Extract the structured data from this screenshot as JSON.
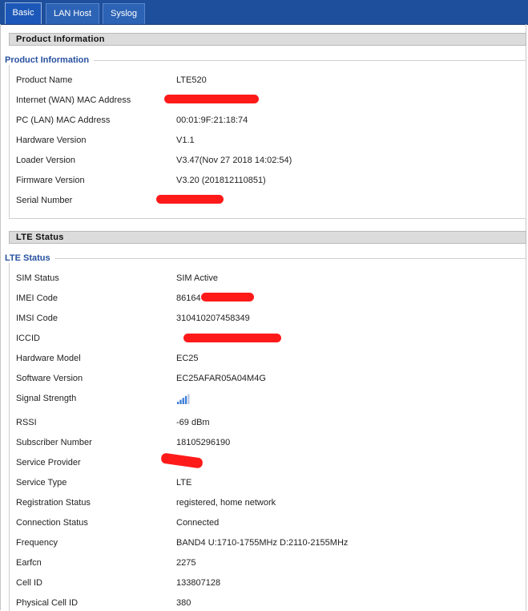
{
  "tabs": [
    {
      "label": "Basic"
    },
    {
      "label": "LAN Host"
    },
    {
      "label": "Syslog"
    }
  ],
  "product_section": {
    "bar_title": "Product Information",
    "legend": "Product Information",
    "rows": [
      {
        "label": "Product Name",
        "value": "LTE520"
      },
      {
        "label": "Internet (WAN) MAC Address",
        "value": ""
      },
      {
        "label": "PC (LAN) MAC Address",
        "value": "00:01:9F:21:18:74"
      },
      {
        "label": "Hardware Version",
        "value": "V1.1"
      },
      {
        "label": "Loader Version",
        "value": "V3.47(Nov 27 2018 14:02:54)"
      },
      {
        "label": "Firmware Version",
        "value": "V3.20 (201812110851)"
      },
      {
        "label": "Serial Number",
        "value": ""
      }
    ]
  },
  "lte_section": {
    "bar_title": "LTE Status",
    "legend": "LTE Status",
    "rows": [
      {
        "label": "SIM Status",
        "value": "SIM Active"
      },
      {
        "label": "IMEI Code",
        "value": "86164"
      },
      {
        "label": "IMSI Code",
        "value": "310410207458349"
      },
      {
        "label": "ICCID",
        "value": ""
      },
      {
        "label": "Hardware Model",
        "value": "EC25"
      },
      {
        "label": "Software Version",
        "value": "EC25AFAR05A04M4G"
      },
      {
        "label": "Signal Strength",
        "value": ""
      },
      {
        "label": "RSSI",
        "value": "-69 dBm"
      },
      {
        "label": "Subscriber Number",
        "value": "18105296190"
      },
      {
        "label": "Service Provider",
        "value": ""
      },
      {
        "label": "Service Type",
        "value": "LTE"
      },
      {
        "label": "Registration Status",
        "value": "registered, home network"
      },
      {
        "label": "Connection Status",
        "value": "Connected"
      },
      {
        "label": "Frequency",
        "value": "BAND4 U:1710-1755MHz D:2110-2155MHz"
      },
      {
        "label": "Earfcn",
        "value": "2275"
      },
      {
        "label": "Cell ID",
        "value": "133807128"
      },
      {
        "label": "Physical Cell ID",
        "value": "380"
      }
    ]
  },
  "signal": {
    "bars_lit": 4,
    "bars_total": 5,
    "color": "#3b7dd8"
  },
  "colors": {
    "tabbar": "#1e4f9c",
    "legend": "#2750a0",
    "redaction": "#ff1a1a"
  }
}
